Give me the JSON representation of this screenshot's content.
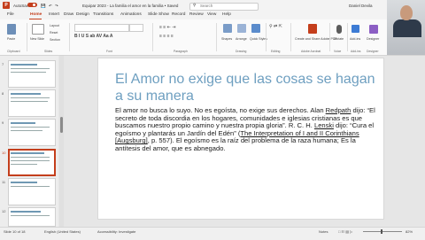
{
  "titlebar": {
    "autosave": "AutoSave",
    "toggle": "On",
    "filename": "Equipar 2023 - La familia el amor en la familia • Saved",
    "search_placeholder": "Search",
    "user": "Daniel Devila"
  },
  "tabs": [
    "File",
    "Home",
    "Insert",
    "Draw",
    "Design",
    "Transitions",
    "Animations",
    "Slide Show",
    "Record",
    "Review",
    "View",
    "Help"
  ],
  "ribbon": {
    "clipboard": "Clipboard",
    "slides": "Slides",
    "font": "Font",
    "paragraph": "Paragraph",
    "drawing": "Drawing",
    "editing": "Editing",
    "adobe": "Adobe Acrobat",
    "voice": "Voice",
    "addins": "Add-ins",
    "designer": "Designer",
    "paste": "Paste",
    "new_slide": "New Slide",
    "layout": "Layout",
    "reset": "Reset",
    "section": "Section",
    "shapes": "Shapes",
    "arrange": "Arrange",
    "quick_styles": "Quick Styles",
    "create_share": "Create and Share Adobe PDF",
    "dictate": "Dictate",
    "add_ins": "Add-ins",
    "designer_btn": "Designer"
  },
  "thumbs": [
    "7",
    "8",
    "9",
    "10",
    "11",
    "12"
  ],
  "slide": {
    "title": "El Amor no exige que las cosas se hagan a su manera",
    "body_1": "El amor no busca lo suyo. No es egoísta, no exige sus derechos. Alan ",
    "body_redpath": "Redpath",
    "body_2": " dijo: “El secreto de toda discordia en los hogares, comunidades e iglesias cristianas es que buscamos nuestro propio camino y nuestra propia gloria”. R. C. H. ",
    "body_lenski": "Lenski",
    "body_3": " dijo: “Cura el egoísmo y plantarás un Jardín del Edén” (",
    "body_interp": "The Interpretation of I and II Corinthians [Augsburg]",
    "body_4": ", p. 557). El egoísmo es la raíz del problema de la raza humana; Es la antítesis del amor, que es abnegado."
  },
  "status": {
    "slide_of": "Slide 10 of 18",
    "language": "English (United States)",
    "accessibility": "Accessibility: Investigate",
    "notes": "Notes",
    "zoom": "82%"
  },
  "colors": {
    "accent": "#c43e1c",
    "title": "#6e9fc0"
  }
}
